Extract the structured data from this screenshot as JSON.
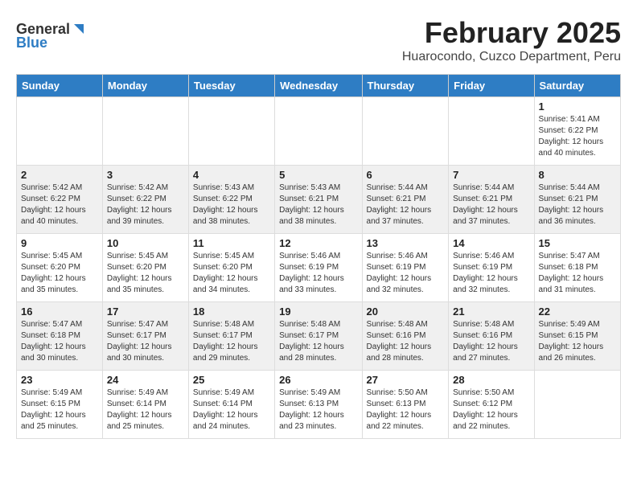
{
  "header": {
    "logo_general": "General",
    "logo_blue": "Blue",
    "title": "February 2025",
    "subtitle": "Huarocondo, Cuzco Department, Peru"
  },
  "weekdays": [
    "Sunday",
    "Monday",
    "Tuesday",
    "Wednesday",
    "Thursday",
    "Friday",
    "Saturday"
  ],
  "weeks": [
    [
      {
        "day": "",
        "info": ""
      },
      {
        "day": "",
        "info": ""
      },
      {
        "day": "",
        "info": ""
      },
      {
        "day": "",
        "info": ""
      },
      {
        "day": "",
        "info": ""
      },
      {
        "day": "",
        "info": ""
      },
      {
        "day": "1",
        "info": "Sunrise: 5:41 AM\nSunset: 6:22 PM\nDaylight: 12 hours\nand 40 minutes."
      }
    ],
    [
      {
        "day": "2",
        "info": "Sunrise: 5:42 AM\nSunset: 6:22 PM\nDaylight: 12 hours\nand 40 minutes."
      },
      {
        "day": "3",
        "info": "Sunrise: 5:42 AM\nSunset: 6:22 PM\nDaylight: 12 hours\nand 39 minutes."
      },
      {
        "day": "4",
        "info": "Sunrise: 5:43 AM\nSunset: 6:22 PM\nDaylight: 12 hours\nand 38 minutes."
      },
      {
        "day": "5",
        "info": "Sunrise: 5:43 AM\nSunset: 6:21 PM\nDaylight: 12 hours\nand 38 minutes."
      },
      {
        "day": "6",
        "info": "Sunrise: 5:44 AM\nSunset: 6:21 PM\nDaylight: 12 hours\nand 37 minutes."
      },
      {
        "day": "7",
        "info": "Sunrise: 5:44 AM\nSunset: 6:21 PM\nDaylight: 12 hours\nand 37 minutes."
      },
      {
        "day": "8",
        "info": "Sunrise: 5:44 AM\nSunset: 6:21 PM\nDaylight: 12 hours\nand 36 minutes."
      }
    ],
    [
      {
        "day": "9",
        "info": "Sunrise: 5:45 AM\nSunset: 6:20 PM\nDaylight: 12 hours\nand 35 minutes."
      },
      {
        "day": "10",
        "info": "Sunrise: 5:45 AM\nSunset: 6:20 PM\nDaylight: 12 hours\nand 35 minutes."
      },
      {
        "day": "11",
        "info": "Sunrise: 5:45 AM\nSunset: 6:20 PM\nDaylight: 12 hours\nand 34 minutes."
      },
      {
        "day": "12",
        "info": "Sunrise: 5:46 AM\nSunset: 6:19 PM\nDaylight: 12 hours\nand 33 minutes."
      },
      {
        "day": "13",
        "info": "Sunrise: 5:46 AM\nSunset: 6:19 PM\nDaylight: 12 hours\nand 32 minutes."
      },
      {
        "day": "14",
        "info": "Sunrise: 5:46 AM\nSunset: 6:19 PM\nDaylight: 12 hours\nand 32 minutes."
      },
      {
        "day": "15",
        "info": "Sunrise: 5:47 AM\nSunset: 6:18 PM\nDaylight: 12 hours\nand 31 minutes."
      }
    ],
    [
      {
        "day": "16",
        "info": "Sunrise: 5:47 AM\nSunset: 6:18 PM\nDaylight: 12 hours\nand 30 minutes."
      },
      {
        "day": "17",
        "info": "Sunrise: 5:47 AM\nSunset: 6:17 PM\nDaylight: 12 hours\nand 30 minutes."
      },
      {
        "day": "18",
        "info": "Sunrise: 5:48 AM\nSunset: 6:17 PM\nDaylight: 12 hours\nand 29 minutes."
      },
      {
        "day": "19",
        "info": "Sunrise: 5:48 AM\nSunset: 6:17 PM\nDaylight: 12 hours\nand 28 minutes."
      },
      {
        "day": "20",
        "info": "Sunrise: 5:48 AM\nSunset: 6:16 PM\nDaylight: 12 hours\nand 28 minutes."
      },
      {
        "day": "21",
        "info": "Sunrise: 5:48 AM\nSunset: 6:16 PM\nDaylight: 12 hours\nand 27 minutes."
      },
      {
        "day": "22",
        "info": "Sunrise: 5:49 AM\nSunset: 6:15 PM\nDaylight: 12 hours\nand 26 minutes."
      }
    ],
    [
      {
        "day": "23",
        "info": "Sunrise: 5:49 AM\nSunset: 6:15 PM\nDaylight: 12 hours\nand 25 minutes."
      },
      {
        "day": "24",
        "info": "Sunrise: 5:49 AM\nSunset: 6:14 PM\nDaylight: 12 hours\nand 25 minutes."
      },
      {
        "day": "25",
        "info": "Sunrise: 5:49 AM\nSunset: 6:14 PM\nDaylight: 12 hours\nand 24 minutes."
      },
      {
        "day": "26",
        "info": "Sunrise: 5:49 AM\nSunset: 6:13 PM\nDaylight: 12 hours\nand 23 minutes."
      },
      {
        "day": "27",
        "info": "Sunrise: 5:50 AM\nSunset: 6:13 PM\nDaylight: 12 hours\nand 22 minutes."
      },
      {
        "day": "28",
        "info": "Sunrise: 5:50 AM\nSunset: 6:12 PM\nDaylight: 12 hours\nand 22 minutes."
      },
      {
        "day": "",
        "info": ""
      }
    ]
  ]
}
